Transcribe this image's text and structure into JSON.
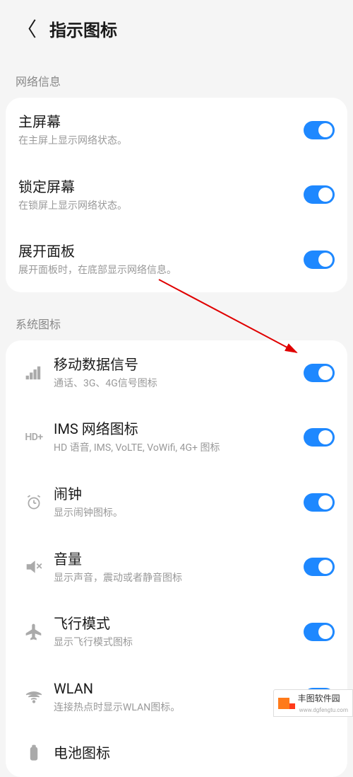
{
  "header": {
    "title": "指示图标"
  },
  "sections": {
    "network": {
      "label": "网络信息",
      "items": [
        {
          "title": "主屏幕",
          "sub": "在主屏上显示网络状态。"
        },
        {
          "title": "锁定屏幕",
          "sub": "在锁屏上显示网络状态。"
        },
        {
          "title": "展开面板",
          "sub": "展开面板时，在底部显示网络信息。"
        }
      ]
    },
    "system": {
      "label": "系统图标",
      "items": [
        {
          "title": "移动数据信号",
          "sub": "通话、3G、4G信号图标"
        },
        {
          "title": "IMS 网络图标",
          "sub": "HD 语音, IMS, VoLTE, VoWifi, 4G+ 图标"
        },
        {
          "title": "闹钟",
          "sub": "显示闹钟图标。"
        },
        {
          "title": "音量",
          "sub": "显示声音，震动或者静音图标"
        },
        {
          "title": "飞行模式",
          "sub": "显示飞行模式图标"
        },
        {
          "title": "WLAN",
          "sub": "连接热点时显示WLAN图标。"
        },
        {
          "title": "电池图标",
          "sub": ""
        }
      ]
    }
  },
  "watermark": {
    "name": "丰图软件园",
    "url": "www.dgfengtu.com"
  }
}
